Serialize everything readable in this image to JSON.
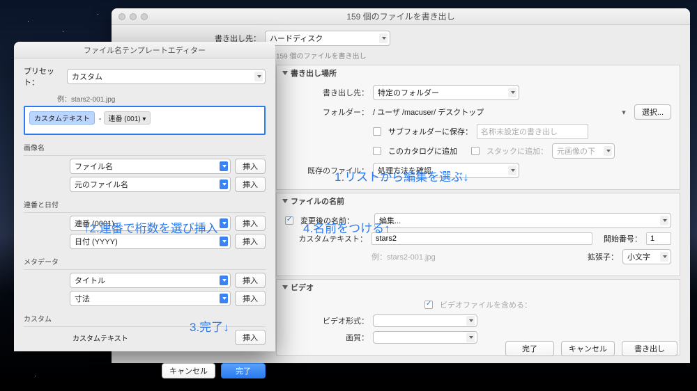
{
  "mainWindow": {
    "title": "159 個のファイルを書き出し",
    "exportTo": {
      "label": "書き出し先：",
      "value": "ハードディスク"
    },
    "subtitle": "159 個のファイルを書き出し",
    "location": {
      "title": "書き出し場所",
      "destLabel": "書き出し先：",
      "destValue": "特定のフォルダー",
      "folderLabel": "フォルダー：",
      "folderValue": "/ ユーザ /macuser/ デスクトップ",
      "chooseBtn": "選択...",
      "subfolder": "サブフォルダーに保存：",
      "subfolderValue": "名称未設定の書き出し",
      "addCatalog": "このカタログに追加",
      "stack": "スタックに追加：",
      "stackValue": "元画像の下",
      "existingLabel": "既存のファイル：",
      "existingValue": "処理方法を確認"
    },
    "filename": {
      "title": "ファイルの名前",
      "renameLabel": "変更後の名前：",
      "renameValue": "編集...",
      "customLabel": "カスタムテキスト：",
      "customValue": "stars2",
      "startLabel": "開始番号：",
      "startValue": "1",
      "example": "例：stars2-001.jpg",
      "extLabel": "拡張子：",
      "extValue": "小文字"
    },
    "video": {
      "title": "ビデオ",
      "include": "ビデオファイルを含める：",
      "formatLabel": "ビデオ形式：",
      "qualityLabel": "画質："
    },
    "buttons": {
      "done": "完了",
      "cancel": "キャンセル",
      "export": "書き出し"
    }
  },
  "editor": {
    "title": "ファイル名テンプレートエディター",
    "presetLabel": "プリセット：",
    "presetValue": "カスタム",
    "exampleLabel": "例：",
    "exampleValue": "stars2-001.jpg",
    "tokens": {
      "custom": "カスタムテキスト",
      "sep": "-",
      "seq": "連番 (001) ▾"
    },
    "imageName": {
      "title": "画像名",
      "opt1": "ファイル名",
      "opt2": "元のファイル名",
      "insert": "挿入"
    },
    "seqDate": {
      "title": "連番と日付",
      "opt1": "連番 (0001)",
      "opt2": "日付 (YYYY)",
      "insert": "挿入"
    },
    "metadata": {
      "title": "メタデータ",
      "opt1": "タイトル",
      "opt2": "寸法",
      "insert": "挿入"
    },
    "custom": {
      "title": "カスタム",
      "label": "カスタムテキスト",
      "insert": "挿入"
    },
    "buttons": {
      "cancel": "キャンセル",
      "done": "完了"
    }
  },
  "annotations": {
    "a1": "1.リストから編集を選ぶ↓",
    "a2": "↑2.連番で桁数を選び挿入",
    "a3": "3.完了↓",
    "a4": "4.名前をつける↑"
  }
}
